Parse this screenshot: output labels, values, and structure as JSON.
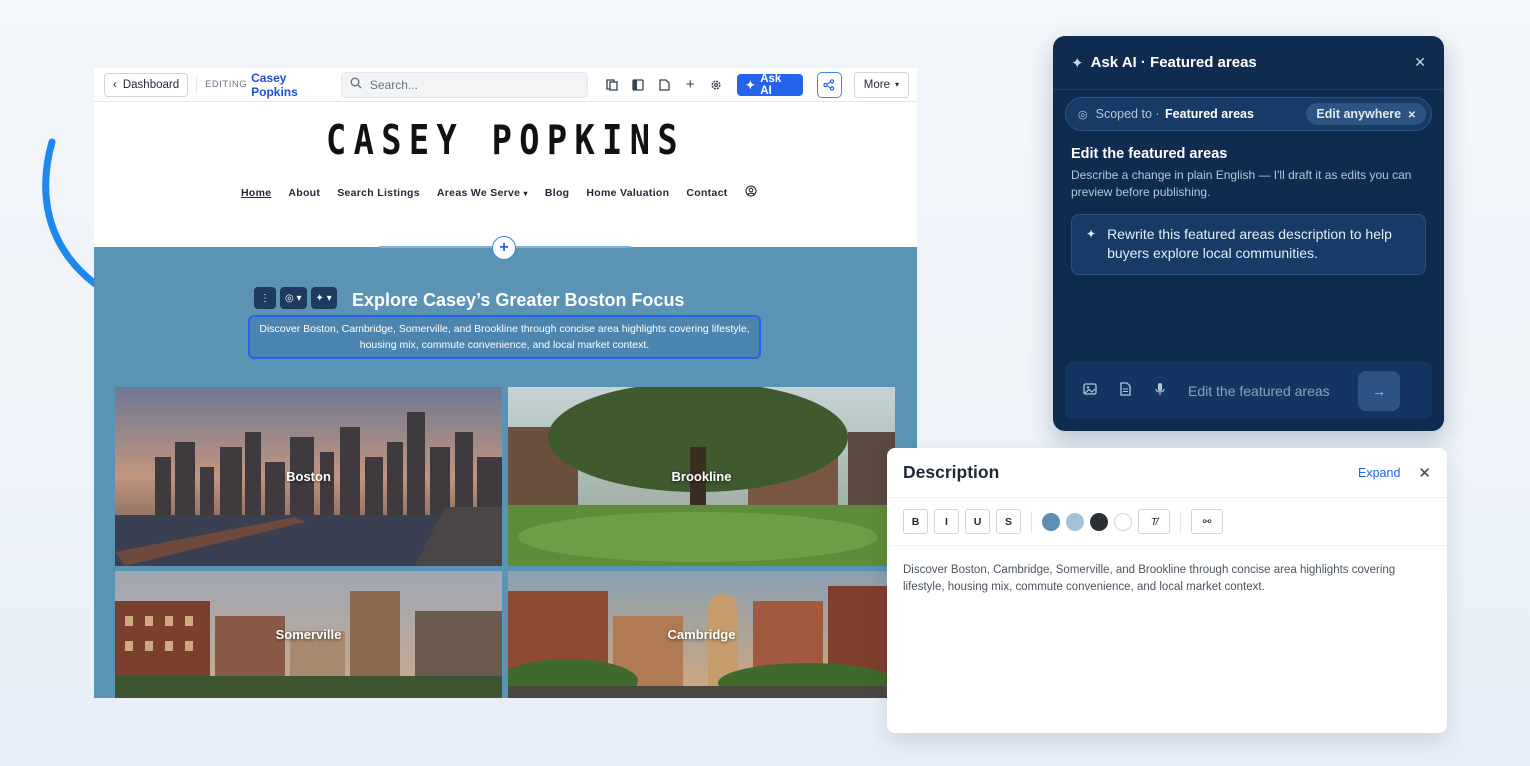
{
  "toolbar": {
    "dashboard_label": "Dashboard",
    "editing_label": "EDITING",
    "site_name": "Casey Popkins",
    "search_placeholder": "Search...",
    "ask_ai_label": "Ask AI",
    "more_label": "More"
  },
  "site": {
    "logo": "CASEY POPKINS",
    "nav": [
      "Home",
      "About",
      "Search Listings",
      "Areas We Serve",
      "Blog",
      "Home Valuation",
      "Contact"
    ],
    "section_title": "Explore Casey’s Greater Boston Focus",
    "section_description": "Discover Boston, Cambridge, Somerville, and Brookline through concise area highlights covering lifestyle, housing mix, commute convenience, and local market context.",
    "areas": [
      "Boston",
      "Brookline",
      "Somerville",
      "Cambridge"
    ]
  },
  "ask_ai": {
    "title": "Ask AI · Featured areas",
    "scope_prefix": "Scoped to ·",
    "scope_target": "Featured areas",
    "edit_anywhere": "Edit anywhere",
    "heading": "Edit the featured areas",
    "subtext": "Describe a change in plain English — I'll draft it as edits you can preview before publishing.",
    "suggestion": "Rewrite this featured areas description to help buyers explore local communities.",
    "input_placeholder": "Edit the featured areas"
  },
  "description_panel": {
    "title": "Description",
    "expand_label": "Expand",
    "format_buttons": [
      "B",
      "I",
      "U",
      "S"
    ],
    "swatch_colors": [
      "#5b8fb3",
      "#a3c2d6",
      "#2d2f36",
      "#ffffff"
    ],
    "text": "Discover Boston, Cambridge, Somerville, and Brookline through concise area highlights covering lifestyle, housing mix, commute convenience, and local market context."
  },
  "colors": {
    "accent": "#2563eb",
    "section_bg": "#5b93b5",
    "ai_panel_bg": "#0f2b4f"
  }
}
